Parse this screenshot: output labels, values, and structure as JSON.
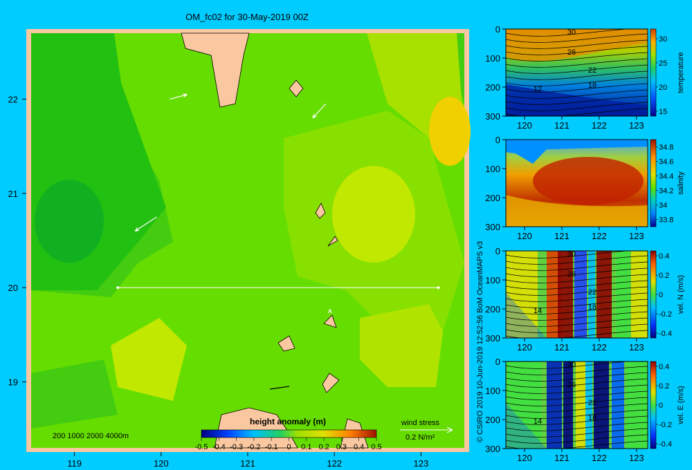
{
  "title": "OM_fc02 for 30-May-2019 00Z",
  "credit": "© CSIRO 2019  10-Jun-2019 12:52:56 BoM OceanMAPS v3",
  "colors": {
    "background": "#00ccff",
    "land": "#fac8a0",
    "frame": "#fac8a0"
  },
  "chart_data": [
    {
      "type": "heatmap",
      "name": "map",
      "x_ticks": [
        119,
        120,
        121,
        122,
        123
      ],
      "y_ticks": [
        19,
        20,
        21,
        22
      ],
      "xlim": [
        118.5,
        123.5
      ],
      "ylim": [
        18.3,
        22.7
      ],
      "colorbar": {
        "label": "height anomaly (m)",
        "ticks": [
          "-0.5",
          "-0.4",
          "-0.3",
          "-0.2",
          "-0.1",
          "0",
          "0.1",
          "0.2",
          "0.3",
          "0.4",
          "0.5"
        ],
        "range": [
          -0.5,
          0.5
        ]
      },
      "depth_legend": "200  1000  2000  4000m",
      "wind_legend": {
        "label": "wind stress",
        "value": "0.2 N/m²"
      },
      "section_line": {
        "lat": 20,
        "lon_start": 119.5,
        "lon_end": 123.2
      },
      "wind_arrows": [
        {
          "lon": 120.1,
          "lat": 22.0,
          "dx": 0.2,
          "dy": 0.05
        },
        {
          "lon": 121.9,
          "lat": 21.95,
          "dx": -0.15,
          "dy": -0.15
        },
        {
          "lon": 119.95,
          "lat": 20.75,
          "dx": -0.25,
          "dy": -0.15
        },
        {
          "lon": 121.95,
          "lat": 19.75,
          "dx": 0.0,
          "dy": 0.02
        }
      ]
    },
    {
      "type": "heatmap",
      "name": "temperature-section",
      "x_ticks": [
        120,
        121,
        122,
        123
      ],
      "y_ticks": [
        0,
        100,
        200,
        300
      ],
      "colorbar": {
        "label": "temperature",
        "ticks": [
          "30",
          "25",
          "20",
          "15"
        ],
        "range": [
          14,
          32
        ]
      },
      "contour_labels": [
        "30",
        "26",
        "22",
        "18",
        "12"
      ]
    },
    {
      "type": "heatmap",
      "name": "salinity-section",
      "x_ticks": [
        120,
        121,
        122,
        123
      ],
      "y_ticks": [
        0,
        100,
        200,
        300
      ],
      "colorbar": {
        "label": "salinity",
        "ticks": [
          "34.8",
          "34.6",
          "34.4",
          "34.2",
          "34",
          "33.8"
        ],
        "range": [
          33.7,
          34.9
        ]
      }
    },
    {
      "type": "heatmap",
      "name": "velocity-north-section",
      "x_ticks": [
        120,
        121,
        122,
        123
      ],
      "y_ticks": [
        0,
        100,
        200,
        300
      ],
      "colorbar": {
        "label": "vel. N (m/s)",
        "ticks": [
          "0.4",
          "0.2",
          "0",
          "-0.2",
          "-0.4"
        ],
        "range": [
          -0.45,
          0.45
        ]
      },
      "contour_labels": [
        "30",
        "26",
        "22",
        "18",
        "14"
      ]
    },
    {
      "type": "heatmap",
      "name": "velocity-east-section",
      "x_ticks": [
        120,
        121,
        122,
        123
      ],
      "y_ticks": [
        0,
        100,
        200,
        300
      ],
      "colorbar": {
        "label": "vel. E (m/s)",
        "ticks": [
          "0.4",
          "0.2",
          "0",
          "-0.2",
          "-0.4"
        ],
        "range": [
          -0.45,
          0.45
        ]
      },
      "contour_labels": [
        "30",
        "26",
        "22",
        "18",
        "14"
      ]
    }
  ]
}
